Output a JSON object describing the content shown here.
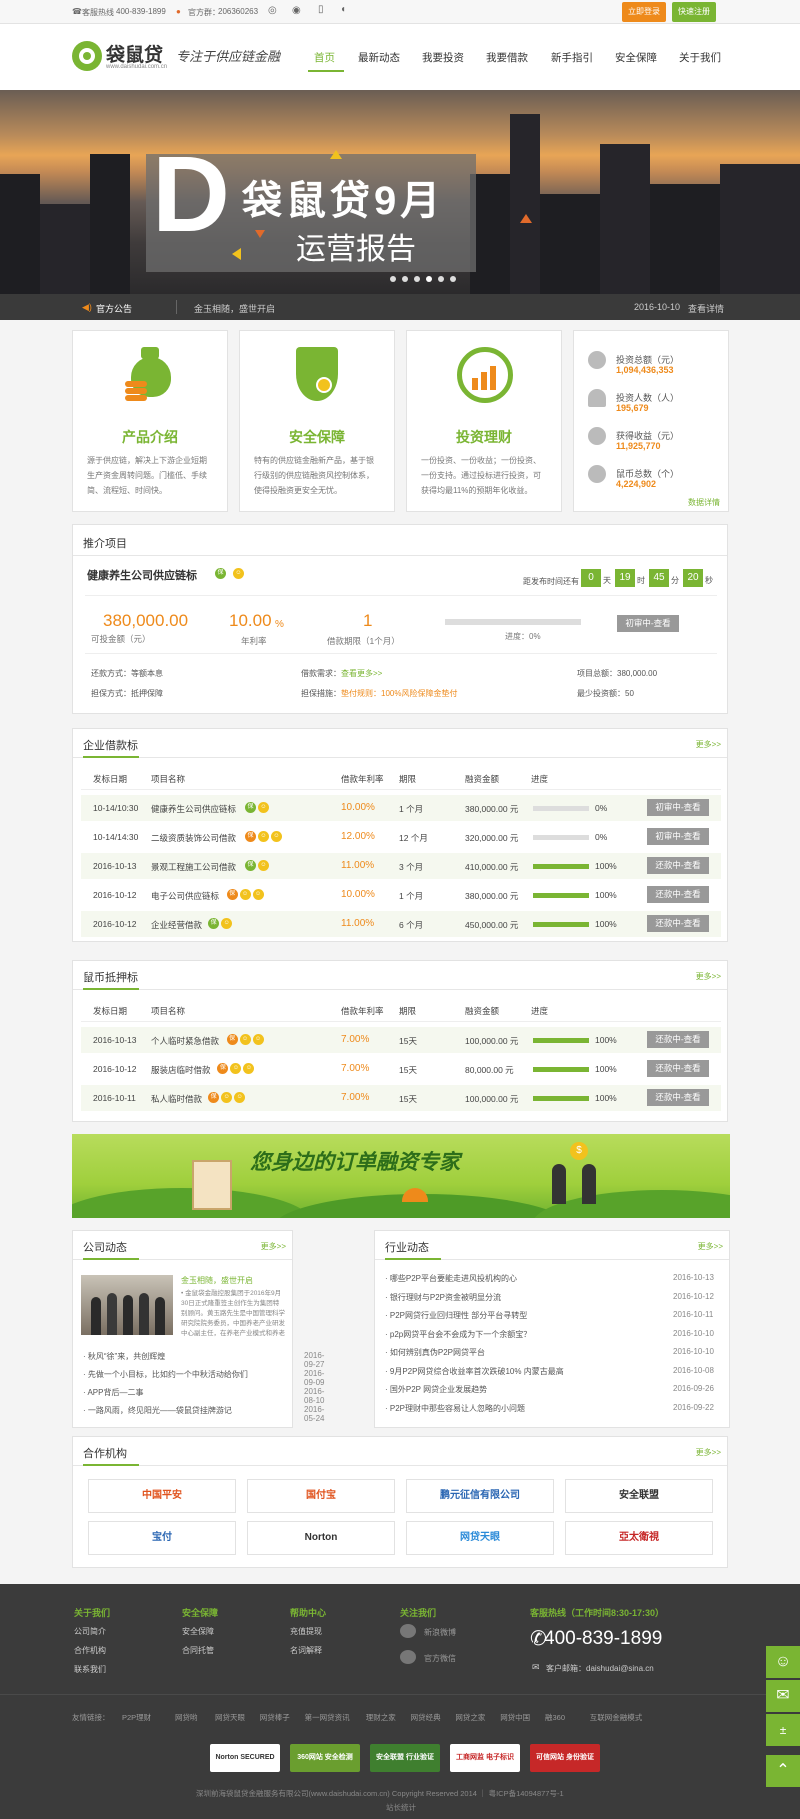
{
  "topbar": {
    "hotline_label": "客服热线",
    "hotline": "400-839-1899",
    "qq_label": "官方群：",
    "qq": "206360263",
    "login": "立即登录",
    "register": "快速注册"
  },
  "brand": {
    "name": "袋鼠贷",
    "domain": "www.daishudai.com.cn",
    "slogan": "专注于供应链金融"
  },
  "nav": [
    "首页",
    "最新动态",
    "我要投资",
    "我要借款",
    "新手指引",
    "安全保障",
    "关于我们"
  ],
  "banner": {
    "letter": "D",
    "title": "袋鼠贷9月",
    "subtitle": "运营报告"
  },
  "notice": {
    "label": "官方公告",
    "text": "金玉相随，盛世开启",
    "date": "2016-10-10",
    "detail": "查看详情"
  },
  "features": [
    {
      "title": "产品介绍",
      "desc": "源于供应链，解决上下游企业短期生产资金周转问题。门槛低、手续简、流程短、时间快。"
    },
    {
      "title": "安全保障",
      "desc": "特有的供应链金融新产品，基于银行级别的供应链融资风控制体系，使得投融资更安全无忧。"
    },
    {
      "title": "投资理财",
      "desc": "一份投资、一份收益；一份投资、一份支持。通过投标进行投资，可获得均最11%的预期年化收益。"
    }
  ],
  "stats": [
    {
      "label": "投资总额（元）",
      "value": "1,094,436,353"
    },
    {
      "label": "投资人数（人）",
      "value": "195,679"
    },
    {
      "label": "获得收益（元）",
      "value": "11,925,770"
    },
    {
      "label": "鼠币总数（个）",
      "value": "4,224,902"
    }
  ],
  "stats_more": "数据详情",
  "recommend": {
    "heading": "推介项目",
    "name": "健康养生公司供应链标",
    "countdown_label": "距发布时间还有",
    "cd": [
      {
        "v": "0",
        "u": "天"
      },
      {
        "v": "19",
        "u": "时"
      },
      {
        "v": "45",
        "u": "分"
      },
      {
        "v": "20",
        "u": "秒"
      }
    ],
    "amount": "380,000.00",
    "amount_label": "可投金额（元）",
    "rate": "10.00",
    "rate_unit": "%",
    "rate_label": "年利率",
    "period": "1",
    "period_label": "借款期限（1个月）",
    "progress_label": "进度：0%",
    "progress": 0,
    "btn": "初审中-查看",
    "repay_label": "还款方式：",
    "repay": "等额本息",
    "need_label": "借款需求：",
    "need": "查看更多>>",
    "total_label": "项目总额：",
    "total": "380,000.00",
    "guar_label": "担保方式：",
    "guar": "抵押保障",
    "measure_label": "担保措施：",
    "measure": "垫付规则：100%风险保障金垫付",
    "min_label": "最少投资额：",
    "min": "50"
  },
  "enterprise": {
    "heading": "企业借款标",
    "more": "更多>>",
    "cols": [
      "发标日期",
      "项目名称",
      "借款年利率",
      "期限",
      "融资金额",
      "进度"
    ],
    "rows": [
      {
        "date": "10-14/10:30",
        "name": "健康养生公司供应链标",
        "rate": "10.00%",
        "term": "1 个月",
        "amount": "380,000.00 元",
        "pct": "0%",
        "p": 0,
        "btn": "初审中-查看"
      },
      {
        "date": "10-14/14:30",
        "name": "二级资质装饰公司借款",
        "rate": "12.00%",
        "term": "12 个月",
        "amount": "320,000.00 元",
        "pct": "0%",
        "p": 0,
        "btn": "初审中-查看"
      },
      {
        "date": "2016-10-13",
        "name": "景观工程施工公司借款",
        "rate": "11.00%",
        "term": "3 个月",
        "amount": "410,000.00 元",
        "pct": "100%",
        "p": 1,
        "btn": "还款中-查看"
      },
      {
        "date": "2016-10-12",
        "name": "电子公司供应链标",
        "rate": "10.00%",
        "term": "1 个月",
        "amount": "380,000.00 元",
        "pct": "100%",
        "p": 1,
        "btn": "还款中-查看"
      },
      {
        "date": "2016-10-12",
        "name": "企业经营借款",
        "rate": "11.00%",
        "term": "6 个月",
        "amount": "450,000.00 元",
        "pct": "100%",
        "p": 1,
        "btn": "还款中-查看"
      }
    ]
  },
  "coin": {
    "heading": "鼠币抵押标",
    "more": "更多>>",
    "cols": [
      "发标日期",
      "项目名称",
      "借款年利率",
      "期限",
      "融资金额",
      "进度"
    ],
    "rows": [
      {
        "date": "2016-10-13",
        "name": "个人临时紧急借款",
        "rate": "7.00%",
        "term": "15天",
        "amount": "100,000.00 元",
        "pct": "100%",
        "p": 1,
        "btn": "还款中-查看"
      },
      {
        "date": "2016-10-12",
        "name": "服装店临时借款",
        "rate": "7.00%",
        "term": "15天",
        "amount": "80,000.00 元",
        "pct": "100%",
        "p": 1,
        "btn": "还款中-查看"
      },
      {
        "date": "2016-10-11",
        "name": "私人临时借款",
        "rate": "7.00%",
        "term": "15天",
        "amount": "100,000.00 元",
        "pct": "100%",
        "p": 1,
        "btn": "还款中-查看"
      }
    ]
  },
  "promo": "您身边的订单融资专家",
  "company_news": {
    "heading": "公司动态",
    "more": "更多>>",
    "feature_title": "金玉相随，盛世开启",
    "feature_desc": "• 金鼠袋金融控股集团于2016年9月30日正式隆重签主创作生为集团特别顾问。黄玉路先生是中国管理科学研究院院务委员，中国养老产业研发中心副主任，在养老产业模式和养老",
    "items": [
      {
        "t": "· 秋风“徐”来，共创辉煌",
        "d": "2016-09-27"
      },
      {
        "t": "· 先做一个小目标，比如约一个中秋活动给你们",
        "d": "2016-09-09"
      },
      {
        "t": "· APP背后—二事",
        "d": "2016-08-10"
      },
      {
        "t": "· 一路风雨，终见阳光——袋鼠贷挂牌游记",
        "d": "2016-05-24"
      }
    ]
  },
  "industry_news": {
    "heading": "行业动态",
    "more": "更多>>",
    "items": [
      {
        "t": "· 哪些P2P平台要能走进风投机构的心",
        "d": "2016-10-13"
      },
      {
        "t": "· 银行理财与P2P资金被明显分流",
        "d": "2016-10-12"
      },
      {
        "t": "· P2P网贷行业回归理性 部分平台寻转型",
        "d": "2016-10-11"
      },
      {
        "t": "· p2p网贷平台会不会成为下一个余额宝？",
        "d": "2016-10-10"
      },
      {
        "t": "· 如何辨别真伪P2P网贷平台",
        "d": "2016-10-10"
      },
      {
        "t": "· 9月P2P网贷综合收益率首次跌破10% 内蒙古最高",
        "d": "2016-10-08"
      },
      {
        "t": "· 国外P2P 网贷企业发展趋势",
        "d": "2016-09-26"
      },
      {
        "t": "· P2P理财中那些容易让人忽略的小问题",
        "d": "2016-09-22"
      }
    ]
  },
  "partners": {
    "heading": "合作机构",
    "more": "更多>>",
    "logos": [
      "中国平安",
      "国付宝",
      "鹏元征信有限公司",
      "安全联盟",
      "宝付",
      "Norton",
      "网贷天眼",
      "亞太衛視"
    ]
  },
  "footer": {
    "cols": [
      {
        "h": "关于我们",
        "items": [
          "公司简介",
          "合作机构",
          "联系我们"
        ]
      },
      {
        "h": "安全保障",
        "items": [
          "安全保障",
          "合同托管"
        ]
      },
      {
        "h": "帮助中心",
        "items": [
          "充值提现",
          "名词解释"
        ]
      },
      {
        "h": "关注我们",
        "items": [
          "新浪微博",
          "官方微信"
        ]
      }
    ],
    "service_h": "客服热线（工作时间8:30-17:30）",
    "phone": "400-839-1899",
    "email": "客户邮箱：daishudai@sina.cn",
    "links_label": "友情链接：",
    "links": [
      "P2P理财",
      "网贷哟",
      "网贷天眼",
      "网贷棒子",
      "第一网贷资讯",
      "理财之家",
      "网贷经典",
      "网贷之家",
      "网贷中国",
      "融360",
      "互联网金融模式"
    ],
    "badges": [
      "Norton SECURED",
      "360网站 安全检测",
      "安全联盟 行业验证",
      "工商网监 电子标识",
      "可信网站 身份验证"
    ],
    "copyright": "深圳前海袋鼠贷金融服务有限公司(www.daishudai.com.cn) Copyright Reserved 2014 ｜ 粤ICP备14094877号-1",
    "stat": "站长统计"
  },
  "colors": {
    "green": "#7ab533",
    "orange": "#ee8a1b",
    "dark": "#3b3b3b"
  }
}
